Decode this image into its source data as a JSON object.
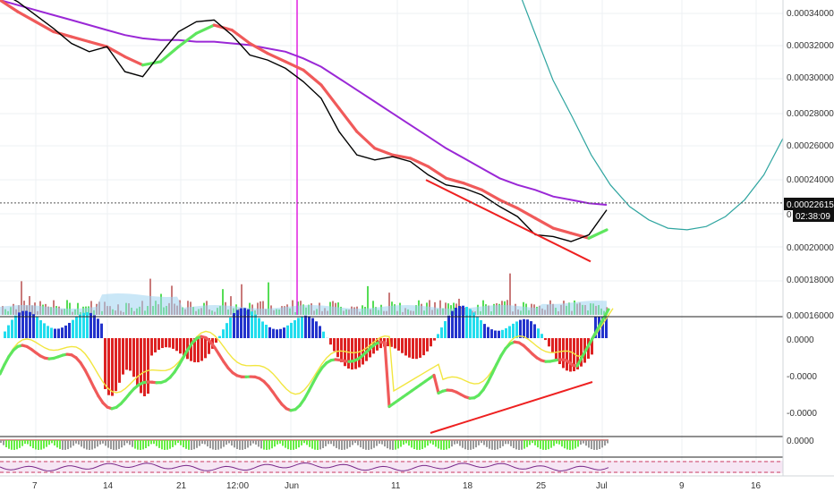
{
  "chart_data": {
    "type": "line",
    "x_labels": [
      "7",
      "14",
      "21",
      "12:00",
      "Jun",
      "11",
      "18",
      "25",
      "Jul",
      "9",
      "16"
    ],
    "price_axis": {
      "ticks": [
        "0.00034000",
        "0.00032000",
        "0.00030000",
        "0.00028000",
        "0.00026000",
        "0.00024000",
        "0.00020000",
        "0.00018000",
        "0.00016000"
      ],
      "range": [
        0.00016,
        0.00035
      ]
    },
    "last_price": {
      "label": "0.00022615",
      "value": 0.00022615
    },
    "countdown": {
      "label": "02:38:09"
    },
    "price_series": {
      "name": "",
      "values": [
        0.000353,
        0.000347,
        0.000339,
        0.000331,
        0.000322,
        0.000317,
        0.00032,
        0.000305,
        0.000302,
        0.000316,
        0.000329,
        0.000335,
        0.000336,
        0.000327,
        0.000315,
        0.000312,
        0.000307,
        0.000299,
        0.000289,
        0.000269,
        0.000255,
        0.000252,
        0.000254,
        0.000251,
        0.000243,
        0.000237,
        0.000235,
        0.000231,
        0.000224,
        0.000218,
        0.000207,
        0.000206,
        0.000203,
        0.000207,
        0.000222
      ]
    },
    "ema_fast": {
      "values": [
        0.000348,
        0.000341,
        0.000335,
        0.000329,
        0.000326,
        0.000323,
        0.00032,
        0.000314,
        0.000309,
        0.000311,
        0.00032,
        0.000328,
        0.000333,
        0.00033,
        0.000322,
        0.000316,
        0.000311,
        0.000306,
        0.000297,
        0.000283,
        0.000269,
        0.000259,
        0.000255,
        0.000253,
        0.000248,
        0.000241,
        0.000238,
        0.000234,
        0.000228,
        0.000223,
        0.000217,
        0.000211,
        0.000208,
        0.000205,
        0.00021
      ]
    },
    "ema_slow": {
      "values": [
        0.000348,
        0.000345,
        0.000342,
        0.000339,
        0.000336,
        0.000333,
        0.00033,
        0.000327,
        0.000325,
        0.000324,
        0.000324,
        0.000323,
        0.000323,
        0.000322,
        0.000321,
        0.000319,
        0.000317,
        0.000313,
        0.000308,
        0.000301,
        0.000294,
        0.000287,
        0.00028,
        0.000273,
        0.000266,
        0.000259,
        0.000253,
        0.000247,
        0.000241,
        0.000237,
        0.000234,
        0.00023,
        0.000228,
        0.000226,
        0.000225
      ]
    },
    "curve_projection": {
      "values": [
        0.00036,
        0.00033,
        0.0003,
        0.000278,
        0.000255,
        0.000237,
        0.000224,
        0.000216,
        0.000211,
        0.00021,
        0.000212,
        0.000218,
        0.000228,
        0.000243,
        0.000265
      ]
    },
    "price_trendline": {
      "from": 0.00024,
      "to": 0.000191
    },
    "oscillator_trendline": {
      "from": -6e-05,
      "to": -4e-05
    },
    "oscillator_axis": {
      "ticks": [
        "0.0000",
        "-0.0000",
        "-0.0000"
      ]
    },
    "volume_axis": {
      "ticks": [
        "0.0000"
      ]
    },
    "colors": {
      "price": "#000000",
      "ema_fast": "#f05a5a",
      "ema_fast_up": "#5ee65e",
      "ema_slow": "#9a28d6",
      "projection": "#2fa5a0",
      "trendline": "#ee2020",
      "vline": "#e020e0",
      "hist_neg": "#dd2222",
      "hist_pos_cyan": "#22ddee",
      "hist_pos_blue": "#2233cc",
      "grid": "#eef0f3"
    },
    "grid": true
  }
}
